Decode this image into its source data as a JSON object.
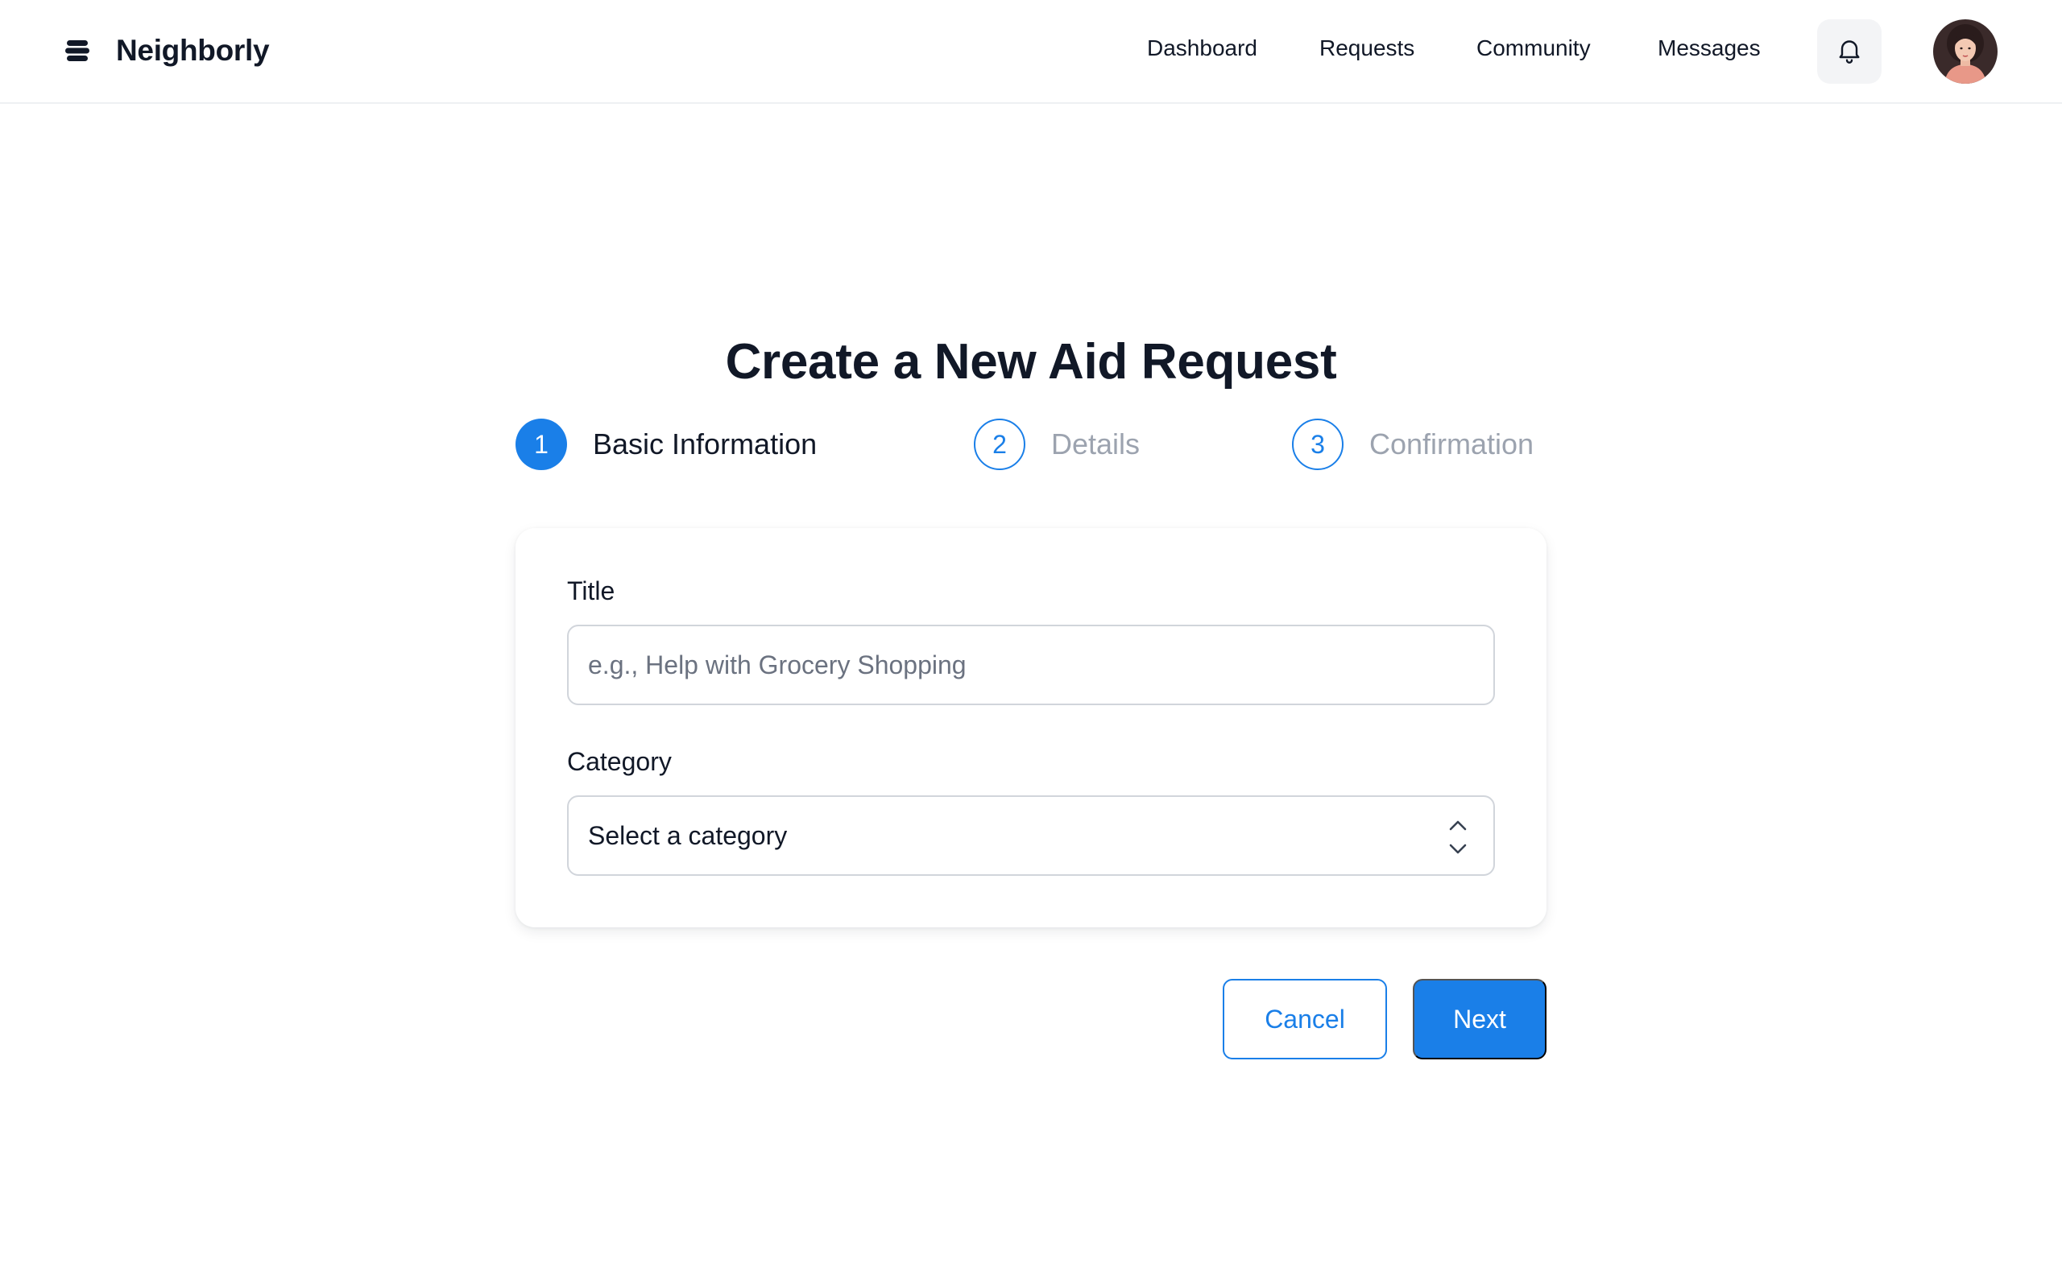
{
  "header": {
    "brand_name": "Neighborly",
    "brand_icon": "stack-logo-icon",
    "nav": [
      {
        "label": "Dashboard"
      },
      {
        "label": "Requests"
      },
      {
        "label": "Community"
      },
      {
        "label": "Messages"
      }
    ],
    "notifications_icon": "bell-icon",
    "avatar_icon": "user-avatar"
  },
  "main": {
    "title": "Create a New Aid Request",
    "steps": [
      {
        "number": "1",
        "label": "Basic Information",
        "state": "active"
      },
      {
        "number": "2",
        "label": "Details",
        "state": "pending"
      },
      {
        "number": "3",
        "label": "Confirmation",
        "state": "pending"
      }
    ],
    "form": {
      "title_label": "Title",
      "title_value": "",
      "title_placeholder": "e.g., Help with Grocery Shopping",
      "category_label": "Category",
      "category_value": "Select a category",
      "category_icon": "chevron-up-down-icon"
    },
    "actions": {
      "cancel_label": "Cancel",
      "next_label": "Next"
    }
  },
  "colors": {
    "accent": "#1a7fe8",
    "text_primary": "#111827",
    "text_muted": "#9ca3af",
    "border": "#d1d5db",
    "bell_bg": "#f3f4f6"
  }
}
